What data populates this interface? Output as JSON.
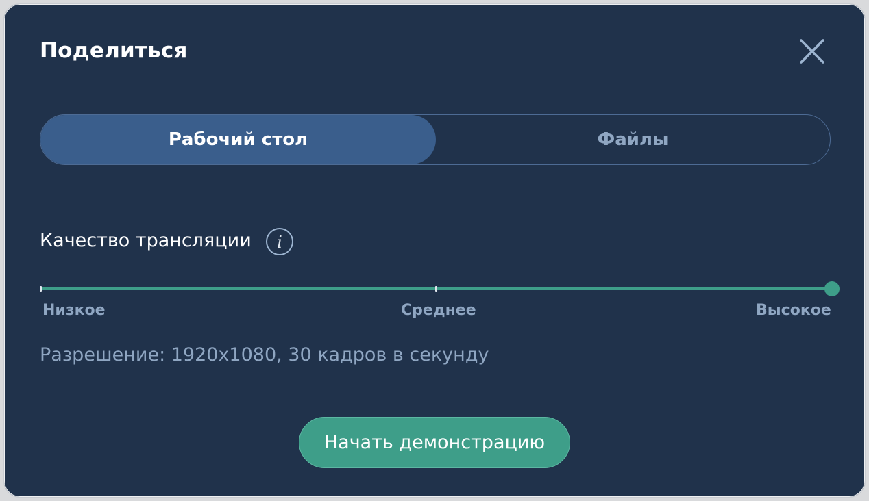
{
  "dialog": {
    "title": "Поделиться",
    "close_icon": "close-icon"
  },
  "tabs": [
    {
      "label": "Рабочий стол",
      "active": true
    },
    {
      "label": "Файлы",
      "active": false
    }
  ],
  "quality": {
    "label": "Качество трансляции",
    "info_icon": "info-icon",
    "levels": [
      "Низкое",
      "Среднее",
      "Высокое"
    ],
    "selected": "Высокое",
    "value": 1.0
  },
  "resolution_text": "Разрешение: 1920x1080, 30 кадров в секунду",
  "start_button": {
    "label": "Начать демонстрацию"
  },
  "colors": {
    "background": "#20324b",
    "accent": "#3e9e89",
    "tab_active": "#3a5e8c",
    "muted_text": "#8fa6c2"
  }
}
